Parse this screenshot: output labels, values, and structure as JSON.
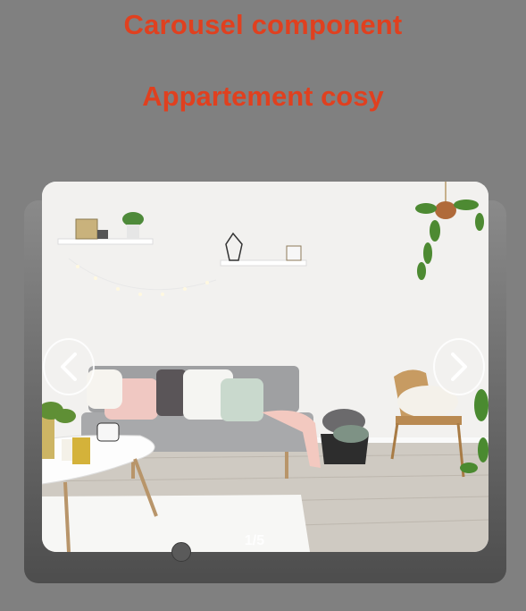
{
  "header": {
    "title": "Carousel component",
    "subtitle": "Appartement cosy"
  },
  "carousel": {
    "counter": "1/5",
    "current_slide": 1,
    "total_slides": 5,
    "slide_image": "living-room-photo",
    "prev_icon": "chevron-left-icon",
    "next_icon": "chevron-right-icon"
  },
  "colors": {
    "background": "#808080",
    "title": "#e0401f",
    "counter_text": "#ffffff"
  }
}
